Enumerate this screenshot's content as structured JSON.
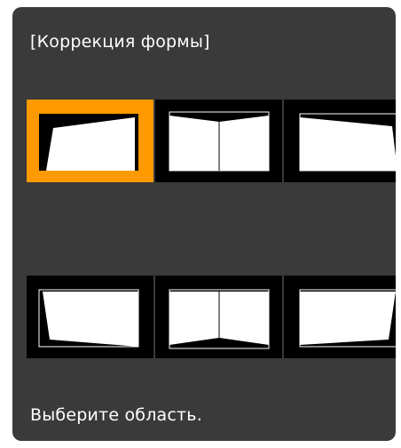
{
  "dialog": {
    "title": "[Коррекция формы]",
    "instruction": "Выберите область."
  },
  "colors": {
    "panel_background": "#3a3a3a",
    "selected_highlight": "#ff9900",
    "tile_background": "#000000",
    "screen_fill": "#ffffff",
    "text": "#ffffff"
  },
  "area_options": [
    {
      "position": "top-left",
      "selected": true,
      "icon": "top-left-corner-shape-icon"
    },
    {
      "position": "top-center",
      "selected": false,
      "icon": "top-edge-shape-icon"
    },
    {
      "position": "top-right",
      "selected": false,
      "icon": "top-right-corner-shape-icon"
    },
    {
      "position": "bottom-left",
      "selected": false,
      "icon": "bottom-left-corner-shape-icon"
    },
    {
      "position": "bottom-center",
      "selected": false,
      "icon": "bottom-edge-shape-icon"
    },
    {
      "position": "bottom-right",
      "selected": false,
      "icon": "bottom-right-corner-shape-icon"
    }
  ]
}
